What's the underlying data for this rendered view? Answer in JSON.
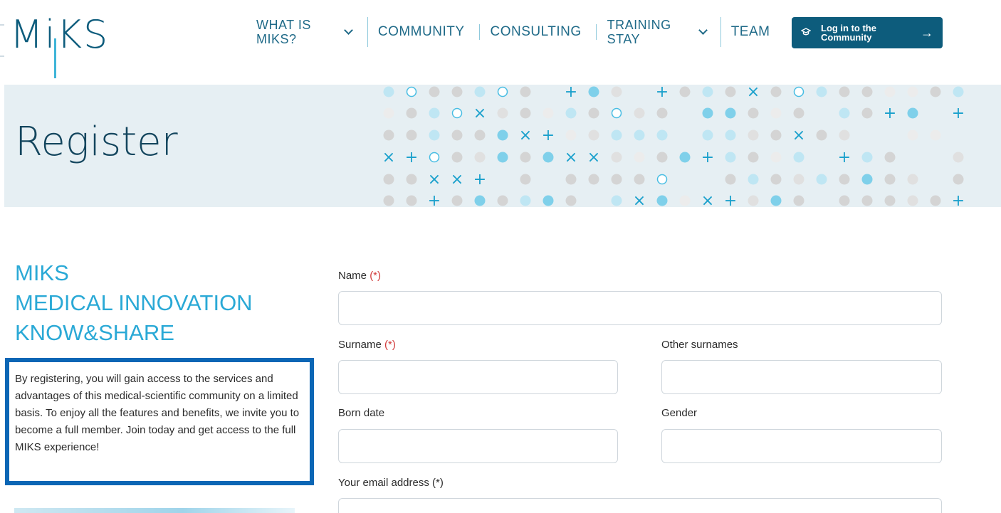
{
  "header": {
    "logo_text": "MiKS",
    "nav": [
      {
        "label": "WHAT IS MIKS?",
        "has_dropdown": true
      },
      {
        "label": "COMMUNITY",
        "has_dropdown": false
      },
      {
        "label": "CONSULTING",
        "has_dropdown": false
      },
      {
        "label": "TRAINING STAY",
        "has_dropdown": true
      },
      {
        "label": "TEAM",
        "has_dropdown": false
      }
    ],
    "nav_line1": [
      "WHAT IS",
      "TRAINING"
    ],
    "nav_line2": [
      "MIKS?",
      "STAY"
    ],
    "login_button": {
      "line1": "Log in to the",
      "line2": "Community",
      "icon": "graduation-cap-icon",
      "arrow": "→"
    }
  },
  "banner": {
    "title": "Register"
  },
  "left": {
    "tagline": [
      "MIKS",
      "MEDICAL INNOVATION",
      "KNOW&SHARE"
    ],
    "info_text": "By registering, you will gain access to the services and advantages of this medical-scientific community on a limited basis. To enjoy all the features and benefits, we invite you to become a full member. Join today and get access to the full MIKS experience!"
  },
  "form": {
    "name_label": "Name",
    "surname_label": "Surname",
    "other_surnames_label": "Other surnames",
    "born_date_label": "Born date",
    "gender_label": "Gender",
    "email_label": "Your email address",
    "required_mark": "(*)",
    "values": {
      "name": "",
      "surname": "",
      "other_surnames": "",
      "born_date": "",
      "gender": "",
      "email": ""
    }
  },
  "colors": {
    "brand_dark": "#0d5c7c",
    "accent": "#2aa9d6",
    "info_border": "#0b66b5",
    "banner_bg": "#e6eff3"
  }
}
